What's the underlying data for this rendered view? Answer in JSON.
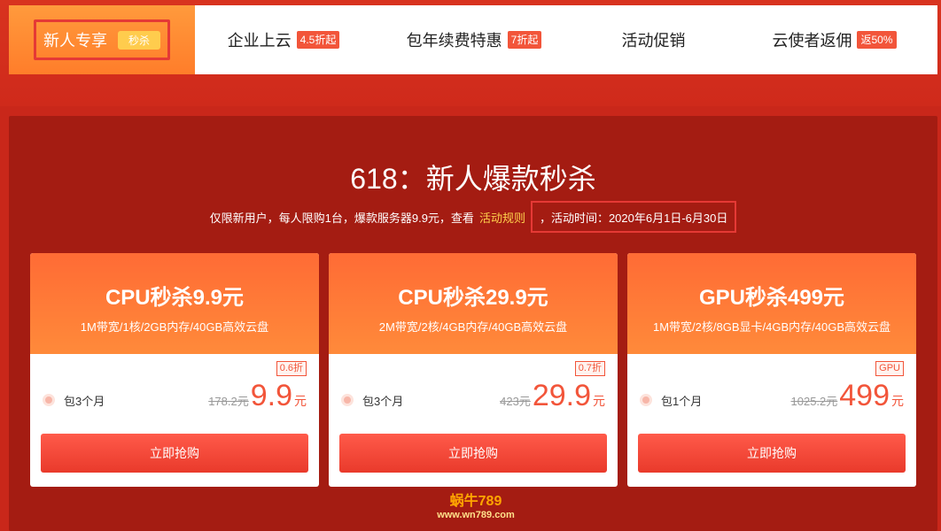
{
  "tabs": {
    "active": {
      "label": "新人专享",
      "badge": "秒杀"
    },
    "items": [
      {
        "label": "企业上云",
        "badge": "4.5折起"
      },
      {
        "label": "包年续费特惠",
        "badge": "7折起"
      },
      {
        "label": "活动促销",
        "badge": ""
      },
      {
        "label": "云使者返佣",
        "badge": "返50%"
      }
    ]
  },
  "promo": {
    "title": "618：新人爆款秒杀",
    "sub_text": "仅限新用户，每人限购1台，爆款服务器9.9元，查看",
    "rule_link": "活动规则",
    "time_text": "，活动时间：2020年6月1日-6月30日"
  },
  "cards": [
    {
      "title": "CPU秒杀9.9元",
      "spec": "1M带宽/1核/2GB内存/40GB高效云盘",
      "discount": "0.6折",
      "period": "包3个月",
      "old_price": "178.2元",
      "price": "9.9",
      "unit": "元",
      "button": "立即抢购"
    },
    {
      "title": "CPU秒杀29.9元",
      "spec": "2M带宽/2核/4GB内存/40GB高效云盘",
      "discount": "0.7折",
      "period": "包3个月",
      "old_price": "423元",
      "price": "29.9",
      "unit": "元",
      "button": "立即抢购"
    },
    {
      "title": "GPU秒杀499元",
      "spec": "1M带宽/2核/8GB显卡/4GB内存/40GB高效云盘",
      "discount": "GPU",
      "period": "包1个月",
      "old_price": "1025.2元",
      "price": "499",
      "unit": "元",
      "button": "立即抢购"
    }
  ],
  "watermark": {
    "line1": "蜗牛789",
    "line2": "www.wn789.com"
  }
}
